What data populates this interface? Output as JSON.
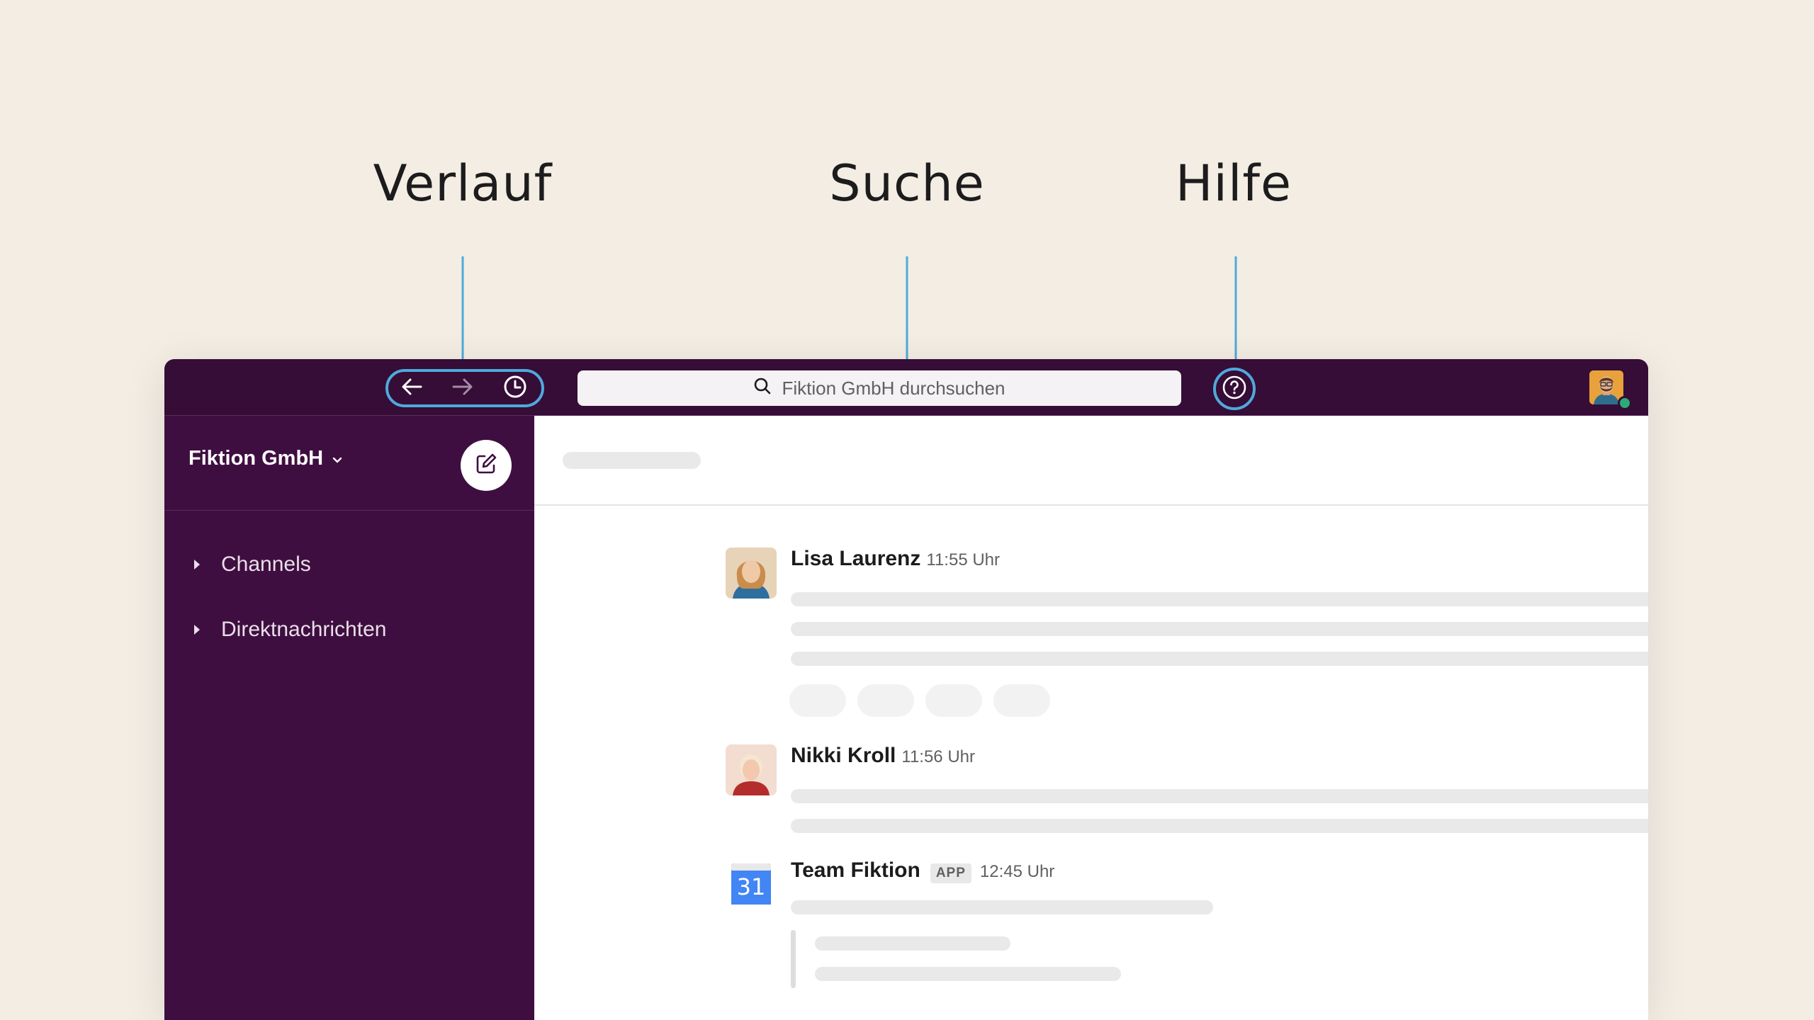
{
  "callouts": {
    "history": "Verlauf",
    "search": "Suche",
    "help": "Hilfe"
  },
  "topbar": {
    "search_placeholder": "Fiktion GmbH durchsuchen",
    "icons": [
      "arrow-left-icon",
      "arrow-right-icon",
      "clock-icon",
      "search-icon",
      "help-icon"
    ]
  },
  "sidebar": {
    "workspace": "Fiktion GmbH",
    "sections": [
      {
        "label": "Channels"
      },
      {
        "label": "Direktnachrichten"
      }
    ]
  },
  "messages": [
    {
      "name": "Lisa Laurenz",
      "time": "11:55 Uhr",
      "badge": ""
    },
    {
      "name": "Nikki Kroll",
      "time": "11:56 Uhr",
      "badge": ""
    },
    {
      "name": "Team Fiktion",
      "time": "12:45 Uhr",
      "badge": "APP",
      "app_icon_text": "31"
    }
  ],
  "colors": {
    "background": "#f3ede4",
    "topbar": "#350d36",
    "sidebar": "#3f0e40",
    "highlight": "#4fa9dc",
    "presence": "#2bac76",
    "calendar_blue": "#4285f4"
  }
}
